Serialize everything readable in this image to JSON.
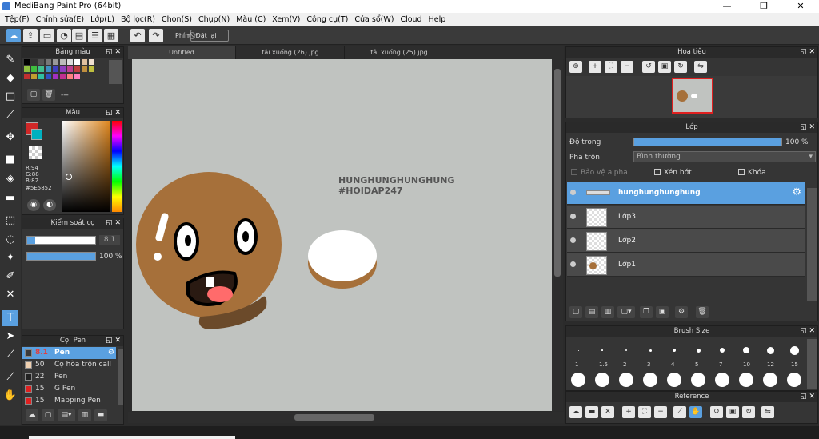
{
  "window": {
    "title": "MediBang Paint Pro (64bit)",
    "minimize": "—",
    "maximize": "❐",
    "close": "✕"
  },
  "menu": [
    "Tệp(F)",
    "Chỉnh sửa(E)",
    "Lớp(L)",
    "Bộ lọc(R)",
    "Chọn(S)",
    "Chụp(N)",
    "Màu (C)",
    "Xem(V)",
    "Công cụ(T)",
    "Cửa sổ(W)",
    "Cloud",
    "Help"
  ],
  "toolbar": {
    "snap_label": "Phím",
    "reset_label": "Đặt lại"
  },
  "palette": {
    "title": "Bảng màu",
    "dash": "---"
  },
  "color": {
    "title": "Màu",
    "r": "R:94",
    "g": "G:88",
    "b": "B:82",
    "hex": "#5E5852",
    "primary": "#5E5852",
    "hue_marker": "#ff8800"
  },
  "brush_control": {
    "title": "Kiểm soát cọ",
    "size": "8.1",
    "opacity": "100 %",
    "opacity_value": 1.0
  },
  "brush_list": {
    "title": "Cọ: Pen",
    "items": [
      {
        "size": "8.1",
        "name": "Pen",
        "color": "#3a3a3a",
        "selected": true
      },
      {
        "size": "50",
        "name": "Cọ hòa trộn call",
        "color": "#f0d0b0",
        "selected": false
      },
      {
        "size": "22",
        "name": "Pen",
        "color": "#222222",
        "selected": false
      },
      {
        "size": "15",
        "name": "G Pen",
        "color": "#e02020",
        "selected": false
      },
      {
        "size": "15",
        "name": "Mapping Pen",
        "color": "#e02020",
        "selected": false
      }
    ]
  },
  "tabs": [
    "Untitled",
    "tải xuống (26).jpg",
    "tải xuống (25).jpg"
  ],
  "canvas": {
    "text1": "HUNGHUNGHUNGHUNG",
    "text2": "#HOIDAP247"
  },
  "navigator": {
    "title": "Hoa tiêu"
  },
  "layer_panel": {
    "title": "Lớp",
    "opacity_label": "Độ trong",
    "opacity_value": "100 %",
    "blend_label": "Pha trộn",
    "blend_value": "Bình thường",
    "protect_alpha": "Bảo vệ alpha",
    "clipping": "Xén bớt",
    "lock": "Khóa",
    "layers": [
      {
        "name": "hunghunghunghung",
        "selected": true
      },
      {
        "name": "Lớp3",
        "selected": false
      },
      {
        "name": "Lớp2",
        "selected": false
      },
      {
        "name": "Lớp1",
        "selected": false
      }
    ]
  },
  "brush_size": {
    "title": "Brush Size",
    "labels": [
      "1",
      "1.5",
      "2",
      "3",
      "4",
      "5",
      "7",
      "10",
      "12",
      "15"
    ]
  },
  "reference": {
    "title": "Reference"
  }
}
